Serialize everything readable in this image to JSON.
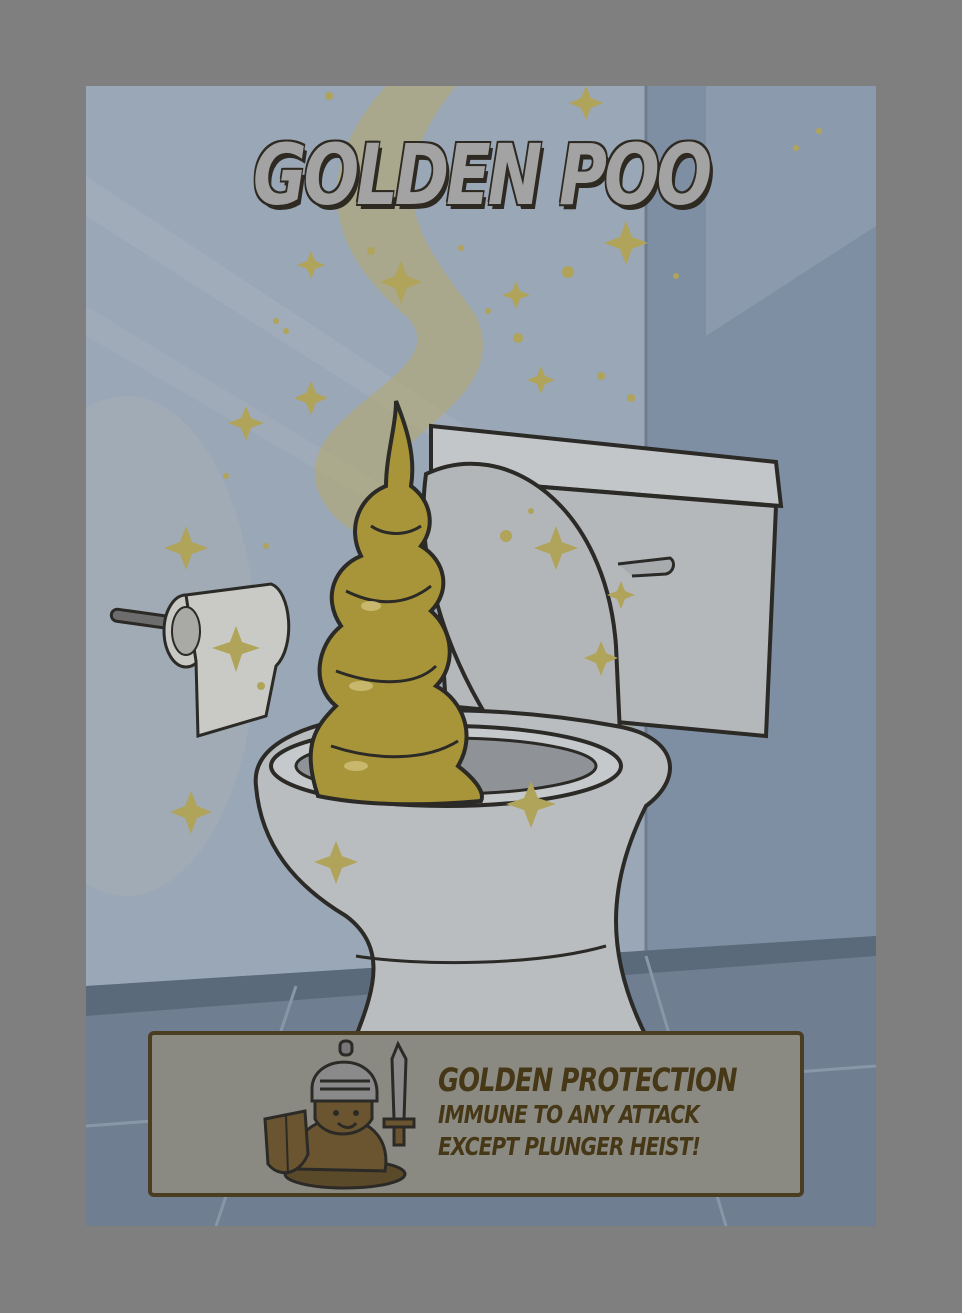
{
  "card": {
    "title": "GOLDEN POO",
    "ability": {
      "name": "GOLDEN PROTECTION",
      "description_line1": "IMMUNE TO ANY ATTACK",
      "description_line2": "EXCEPT PLUNGER HEIST!"
    }
  },
  "colors": {
    "overlay": "#7f7f7f",
    "gold": "#a8953a",
    "ink": "#2b2a26",
    "toilet": "#b9bcbf"
  },
  "icons": {
    "mascot": "knight-poo-icon",
    "sparkle": "sparkle-icon"
  }
}
